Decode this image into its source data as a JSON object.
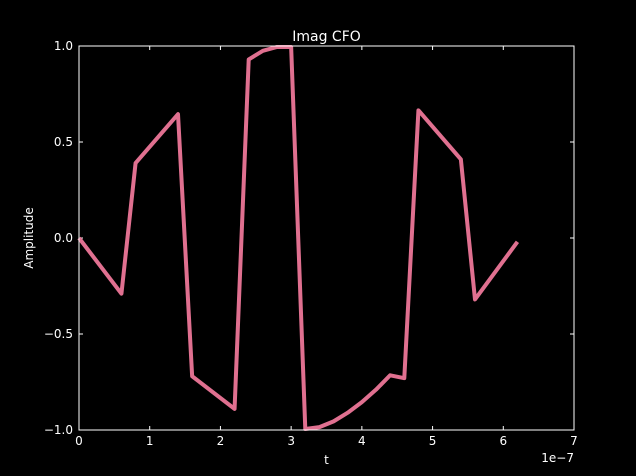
{
  "chart_data": {
    "type": "line",
    "title": "Imag CFO",
    "xlabel": "t",
    "ylabel": "Amplitude",
    "x_offset_label": "1e−7",
    "xlim": [
      0,
      7e-07
    ],
    "ylim": [
      -1.0,
      1.0
    ],
    "x_ticks": [
      0,
      1e-07,
      2e-07,
      3e-07,
      4e-07,
      5e-07,
      6e-07,
      7e-07
    ],
    "x_tick_labels": [
      "0",
      "1",
      "2",
      "3",
      "4",
      "5",
      "6",
      "7"
    ],
    "y_ticks": [
      -1.0,
      -0.5,
      0.0,
      0.5,
      1.0
    ],
    "y_tick_labels": [
      "−1.0",
      "−0.5",
      "0.0",
      "0.5",
      "1.0"
    ],
    "grid": false,
    "background_color": "#000000",
    "axes_color": "#ffffff",
    "series": [
      {
        "color": "#e07090",
        "x": [
          0,
          6e-08,
          8e-08,
          1.4e-07,
          1.6e-07,
          2.2e-07,
          2.4e-07,
          2.6e-07,
          2.8e-07,
          3e-07,
          3.2e-07,
          3.4e-07,
          3.6e-07,
          3.8e-07,
          4e-07,
          4.2e-07,
          4.4e-07,
          4.6e-07,
          4.8e-07,
          5.4e-07,
          5.6e-07,
          6.2e-07
        ],
        "y": [
          0.0,
          -0.29,
          0.39,
          0.645,
          -0.72,
          -0.89,
          0.93,
          0.975,
          0.995,
          0.995,
          -0.995,
          -0.985,
          -0.955,
          -0.91,
          -0.855,
          -0.79,
          -0.715,
          -0.73,
          0.665,
          0.41,
          -0.32,
          -0.02
        ]
      }
    ]
  }
}
